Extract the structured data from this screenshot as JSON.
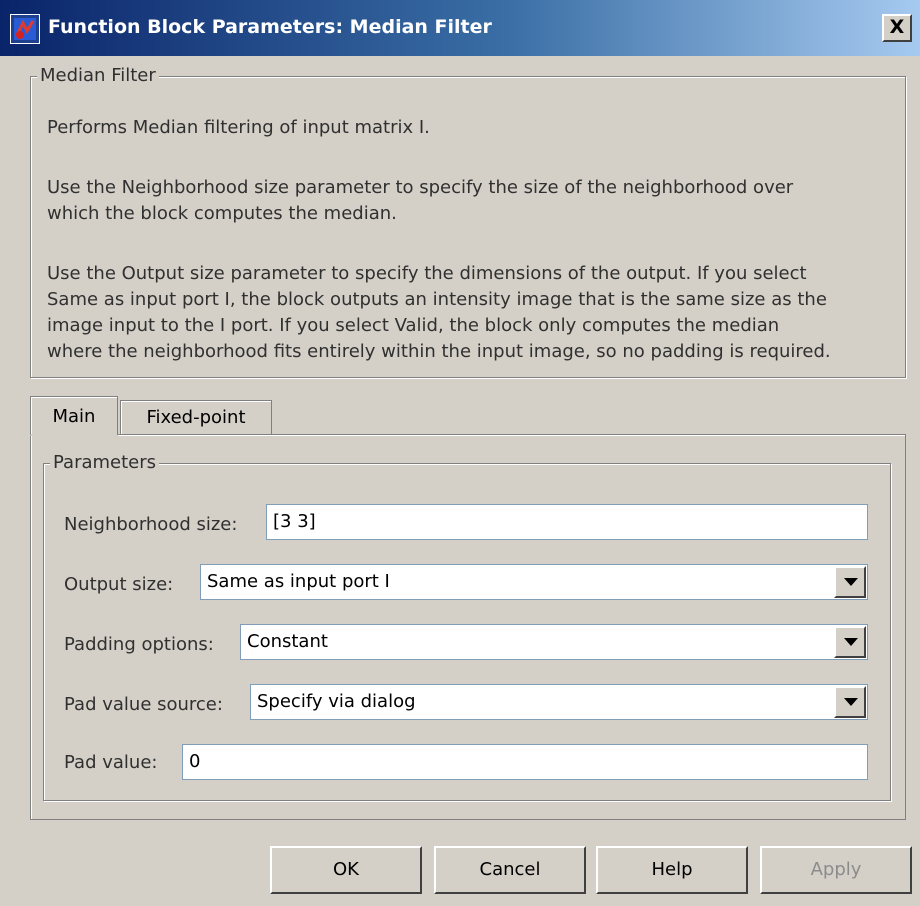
{
  "window": {
    "title": "Function Block Parameters: Median Filter",
    "close_glyph": "X"
  },
  "description": {
    "group_title": "Median Filter",
    "line1": "Performs Median filtering of input matrix I.",
    "line2a": "Use the Neighborhood size parameter to specify the size of the neighborhood over",
    "line2b": "which the block computes the median.",
    "line3a": "Use the Output size parameter to specify the dimensions of the output. If you select",
    "line3b": "Same as input port I, the block outputs an intensity image that is the same size as the",
    "line3c": "image input to the I port. If you select Valid, the block only computes the median",
    "line3d": "where the neighborhood fits entirely within the input image, so no padding is required."
  },
  "tabs": [
    "Main",
    "Fixed-point"
  ],
  "parameters": {
    "group_title": "Parameters",
    "neighborhood_label": "Neighborhood size:",
    "neighborhood_value": "[3 3]",
    "output_size_label": "Output size:",
    "output_size_value": "Same as input port I",
    "padding_label": "Padding options:",
    "padding_value": "Constant",
    "pad_source_label": "Pad value source:",
    "pad_source_value": "Specify via dialog",
    "pad_value_label": "Pad value:",
    "pad_value": "0"
  },
  "buttons": {
    "ok": "OK",
    "cancel": "Cancel",
    "help": "Help",
    "apply": "Apply"
  },
  "icons": {
    "window": "simulink-block-icon",
    "close": "close-icon",
    "dropdown": "chevron-down-icon"
  }
}
